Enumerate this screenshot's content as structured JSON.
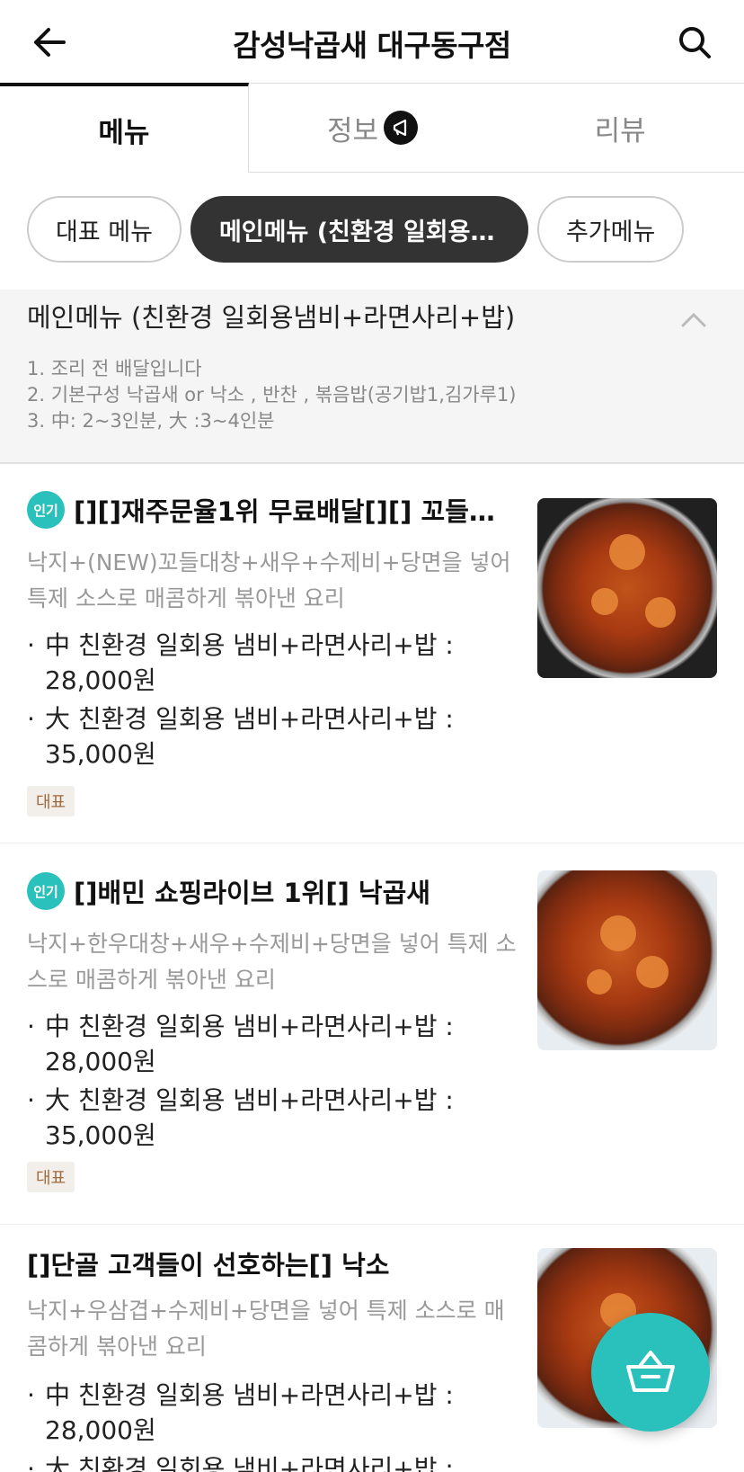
{
  "header": {
    "title": "감성낙곱새 대구동구점",
    "back_icon": "arrow-left-icon",
    "search_icon": "search-icon"
  },
  "tabs": [
    {
      "label": "메뉴",
      "active": true
    },
    {
      "label": "정보",
      "active": false,
      "badge_icon": "megaphone-icon"
    },
    {
      "label": "리뷰",
      "active": false
    }
  ],
  "chips": [
    {
      "label": "대표 메뉴",
      "active": false
    },
    {
      "label": "메인메뉴 (친환경 일회용냄…",
      "active": true
    },
    {
      "label": "추가메뉴",
      "active": false
    }
  ],
  "section": {
    "title": "메인메뉴 (친환경 일회용냄비+라면사리+밥)",
    "desc": [
      "1. 조리 전 배달입니다",
      "2. 기본구성  낙곱새 or 낙소 , 반찬 , 볶음밥(공기밥1,김가루1)",
      "3. 中: 2~3인분, 大 :3~4인분"
    ]
  },
  "items": [
    {
      "badge": "인기",
      "name": "[][]재주문율1위 무료배달[][] 꼬들대…",
      "desc": "낙지+(NEW)꼬들대창+새우+수제비+당면을 넣어 특제 소스로 매콤하게 볶아낸 요리",
      "prices": [
        {
          "dot": "·",
          "label": "中 친환경 일회용 냄비+라면사리+밥 :",
          "price": "28,000원"
        },
        {
          "dot": "·",
          "label": "大 친환경 일회용 냄비+라면사리+밥 :",
          "price": "35,000원"
        }
      ],
      "tag": "대표"
    },
    {
      "badge": "인기",
      "name": "[]배민 쇼핑라이브 1위[] 낙곱새",
      "desc": "낙지+한우대창+새우+수제비+당면을 넣어  특제 소스로 매콤하게 볶아낸 요리",
      "prices": [
        {
          "dot": "·",
          "label": "中 친환경 일회용 냄비+라면사리+밥 :",
          "price": "28,000원"
        },
        {
          "dot": "·",
          "label": "大 친환경 일회용 냄비+라면사리+밥 :",
          "price": "35,000원"
        }
      ],
      "tag": "대표"
    },
    {
      "name": "[]단골 고객들이 선호하는[] 낙소",
      "desc": "낙지+우삼겹+수제비+당면을 넣어  특제 소스로 매콤하게 볶아낸 요리",
      "prices": [
        {
          "dot": "·",
          "label": "中 친환경 일회용 냄비+라면사리+밥 :",
          "price": "28,000원"
        },
        {
          "dot": "·",
          "label": "大 친환경 일회용 냄비+라면사리+밥 :",
          "price": ""
        }
      ]
    }
  ],
  "cart": {
    "icon": "basket-icon"
  },
  "colors": {
    "accent": "#2ac1bc",
    "chip_active": "#333333",
    "tag_text": "#a06a3e"
  }
}
